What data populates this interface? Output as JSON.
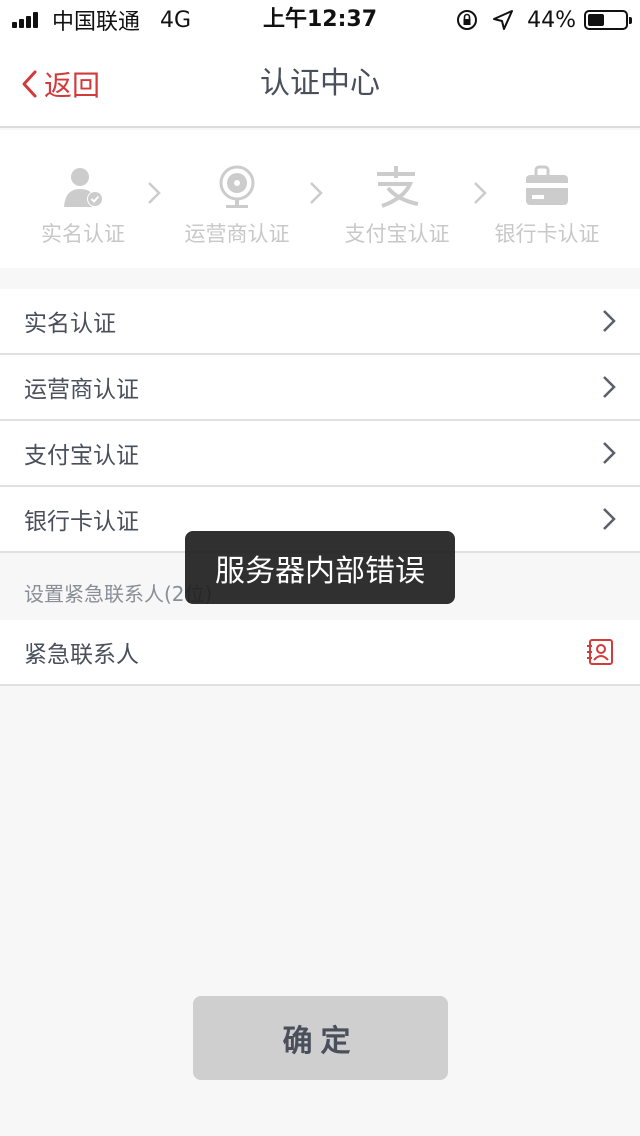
{
  "status_bar": {
    "carrier": "中国联通",
    "network": "4G",
    "time": "上午12:37",
    "battery": "44%",
    "battery_level": 0.44
  },
  "nav": {
    "back_label": "返回",
    "title": "认证中心"
  },
  "steps": [
    {
      "label": "实名认证",
      "icon": "user-verified-icon"
    },
    {
      "label": "运营商认证",
      "icon": "operator-icon"
    },
    {
      "label": "支付宝认证",
      "icon": "alipay-icon"
    },
    {
      "label": "银行卡认证",
      "icon": "bank-card-icon"
    }
  ],
  "list_items": [
    {
      "label": "实名认证"
    },
    {
      "label": "运营商认证"
    },
    {
      "label": "支付宝认证"
    },
    {
      "label": "银行卡认证"
    }
  ],
  "emergency": {
    "section_label": "设置紧急联系人(2位)",
    "contact_label": "紧急联系人"
  },
  "toast": {
    "message": "服务器内部错误"
  },
  "confirm_label": "确定",
  "colors": {
    "accent": "#d33a3a",
    "text": "#4a4f5c",
    "disabled_icon": "#cccccc",
    "button_bg": "#cfcfcf"
  }
}
